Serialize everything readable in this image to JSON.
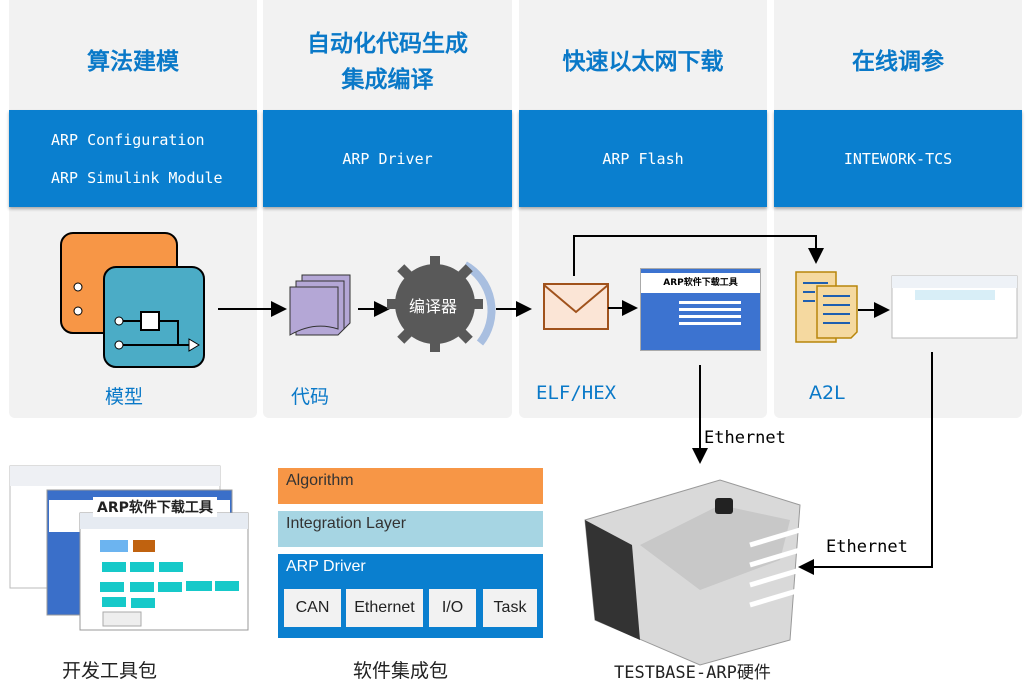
{
  "columns": [
    {
      "title": "算法建模",
      "items": [
        "ARP Configuration",
        "ARP Simulink Module"
      ],
      "label": "模型"
    },
    {
      "title": "自动化代码生成\n集成编译",
      "items": [
        "ARP Driver"
      ],
      "label": "代码",
      "compiler_label": "编译器"
    },
    {
      "title": "快速以太网下载",
      "items": [
        "ARP Flash"
      ],
      "label": "ELF/HEX",
      "tool_title": "ARP软件下载工具"
    },
    {
      "title": "在线调参",
      "items": [
        "INTEWORK-TCS"
      ],
      "label": "A2L"
    }
  ],
  "connections": {
    "ethernet_1": "Ethernet",
    "ethernet_2": "Ethernet"
  },
  "bottom": {
    "devkit": {
      "caption": "开发工具包",
      "screenshot_title": "ARP软件下载工具"
    },
    "package": {
      "caption": "软件集成包",
      "layers": [
        "Algorithm",
        "Integration Layer",
        "ARP Driver"
      ],
      "driver_modules": [
        "CAN",
        "Ethernet",
        "I/O",
        "Task"
      ]
    },
    "hardware": {
      "caption": "TESTBASE-ARP硬件"
    }
  },
  "colors": {
    "accent": "#0a7fcf",
    "algorithm": "#f79646",
    "integration": "#a6d5e3"
  }
}
